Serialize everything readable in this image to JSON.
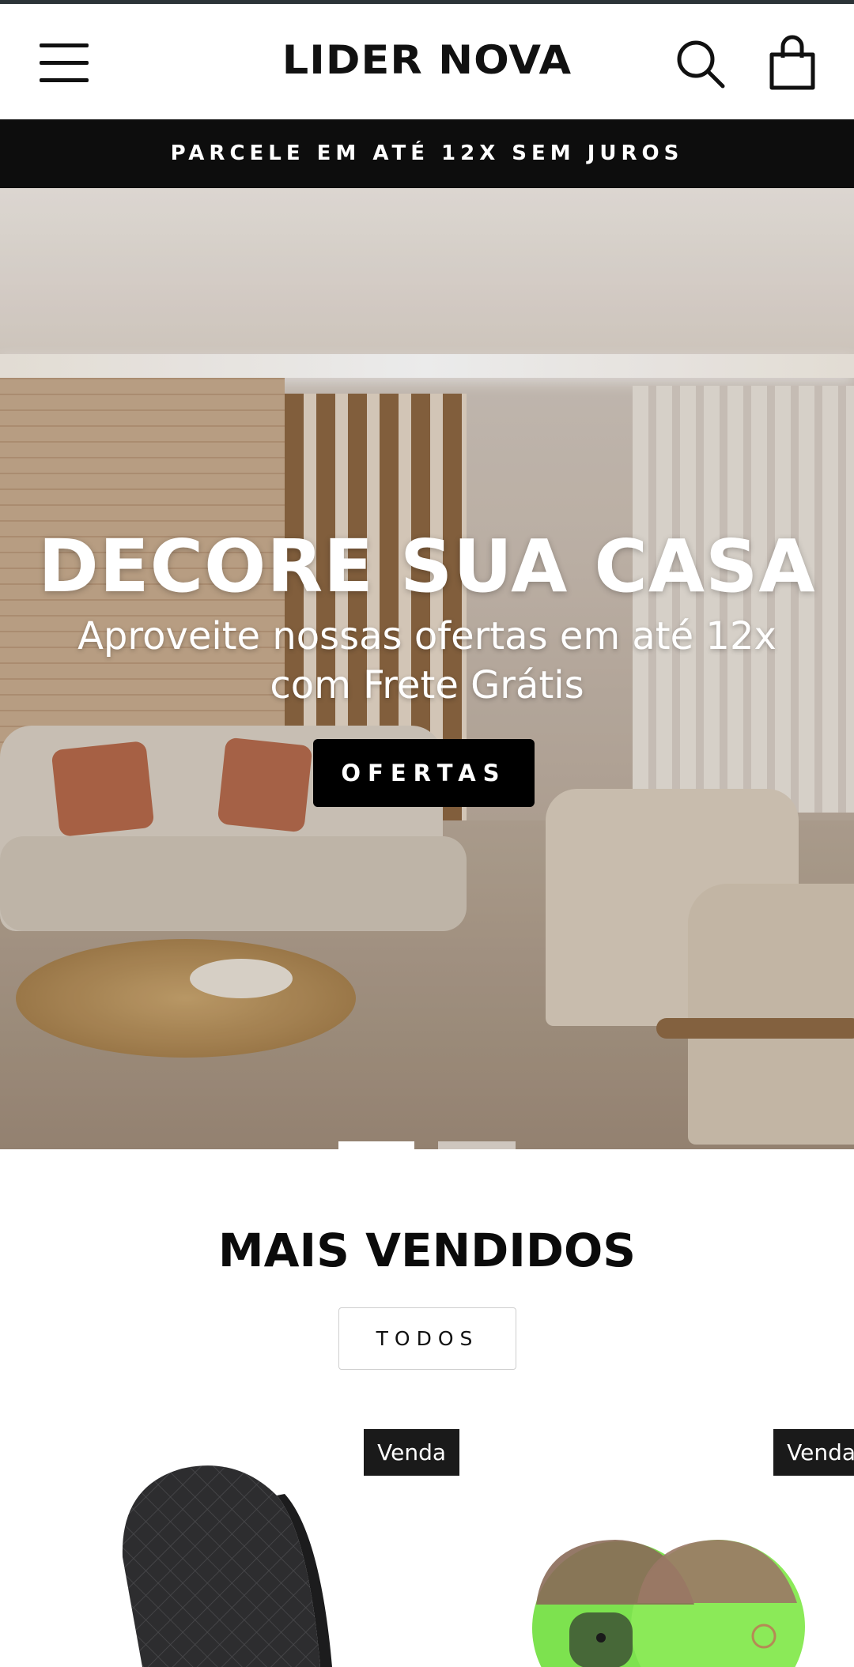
{
  "header": {
    "logo": "LIDER NOVA",
    "menu_icon": "hamburger-menu-icon",
    "search_icon": "search-icon",
    "cart_icon": "shopping-bag-icon"
  },
  "announcement": {
    "text": "PARCELE EM ATÉ 12X SEM JUROS"
  },
  "hero": {
    "title": "DECORE SUA CASA",
    "subtitle": "Aproveite nossas ofertas em até 12x com Frete Grátis",
    "cta_label": "OFERTAS",
    "slides_count": 2,
    "active_slide": 1
  },
  "bestsellers": {
    "title": "MAIS VENDIDOS",
    "all_button": "TODOS",
    "products": [
      {
        "badge": "Venda"
      },
      {
        "badge": "Venda"
      }
    ]
  },
  "colors": {
    "announcement_bg": "#0d0d0d",
    "badge_bg": "#1a1a1a",
    "cta_bg": "#000000"
  }
}
